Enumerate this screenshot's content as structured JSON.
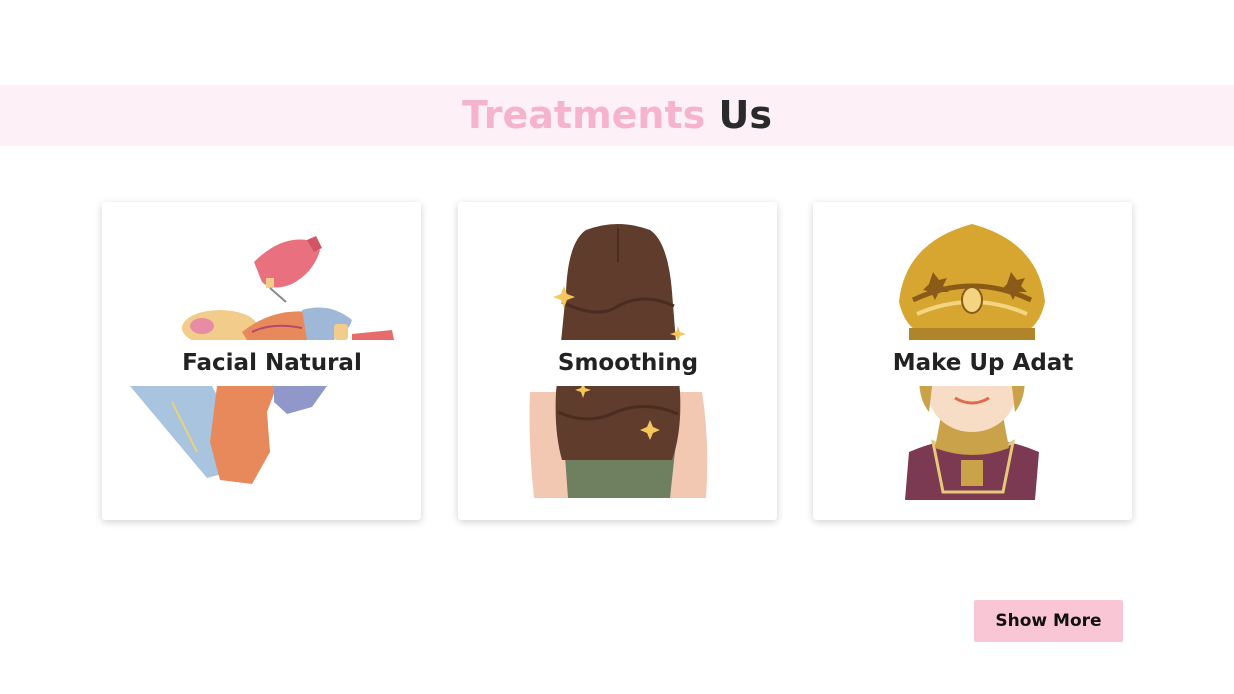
{
  "header": {
    "title_accent": "Treatments",
    "title_rest": "Us",
    "accent_color": "#f6b4cc",
    "band_color": "#fdf0f6"
  },
  "treatments": [
    {
      "label": "Facial Natural",
      "icon": "facial-treatment-illustration"
    },
    {
      "label": "Smoothing",
      "icon": "long-hair-illustration"
    },
    {
      "label": "Make Up Adat",
      "icon": "traditional-bride-illustration"
    }
  ],
  "actions": {
    "show_more_label": "Show More",
    "button_color": "#f9c6d5"
  }
}
